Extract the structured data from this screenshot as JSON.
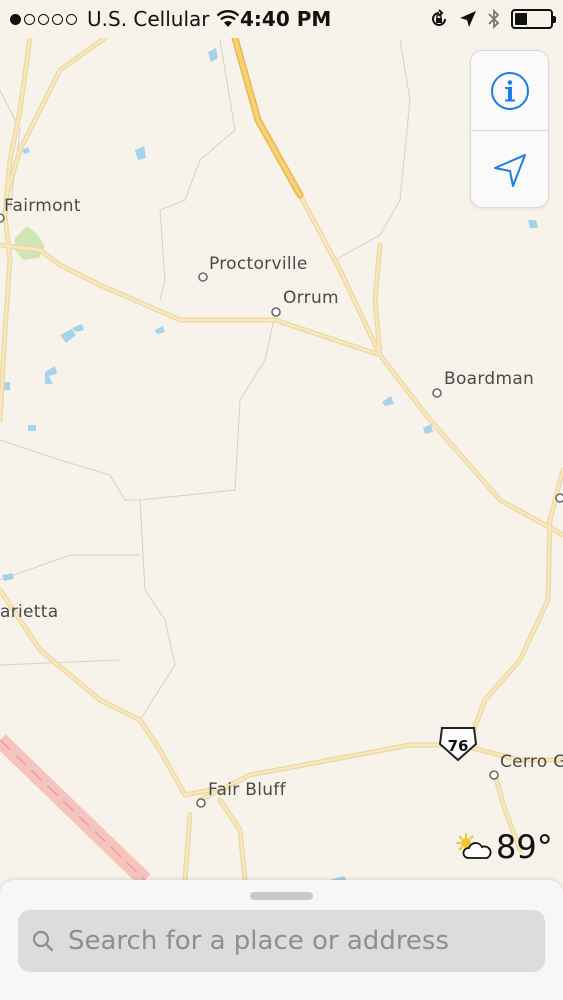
{
  "status_bar": {
    "carrier": "U.S. Cellular",
    "time": "4:40 PM",
    "signal_bars": 1,
    "icons": [
      "wifi-icon",
      "orientation-lock-icon",
      "location-arrow-icon",
      "bluetooth-icon",
      "battery-icon"
    ]
  },
  "map": {
    "places": [
      {
        "name": "Fairmont"
      },
      {
        "name": "Proctorville"
      },
      {
        "name": "Orrum"
      },
      {
        "name": "Boardman"
      },
      {
        "name": "arietta"
      },
      {
        "name": "Fair Bluff"
      },
      {
        "name": "Cerro G"
      }
    ],
    "route_shield": "76",
    "colors": {
      "land": "#f8f3ea",
      "major_road": "#f4cc6a",
      "road": "#f6dfa0",
      "water": "#a6d3ec",
      "park": "#cde6b4"
    }
  },
  "controls": {
    "icons": [
      "info-icon",
      "tracking-arrow-icon"
    ],
    "accent": "#1a7ee8"
  },
  "weather": {
    "icon": "partly-cloudy-icon",
    "temperature": "89°"
  },
  "search": {
    "placeholder": "Search for a place or address"
  }
}
